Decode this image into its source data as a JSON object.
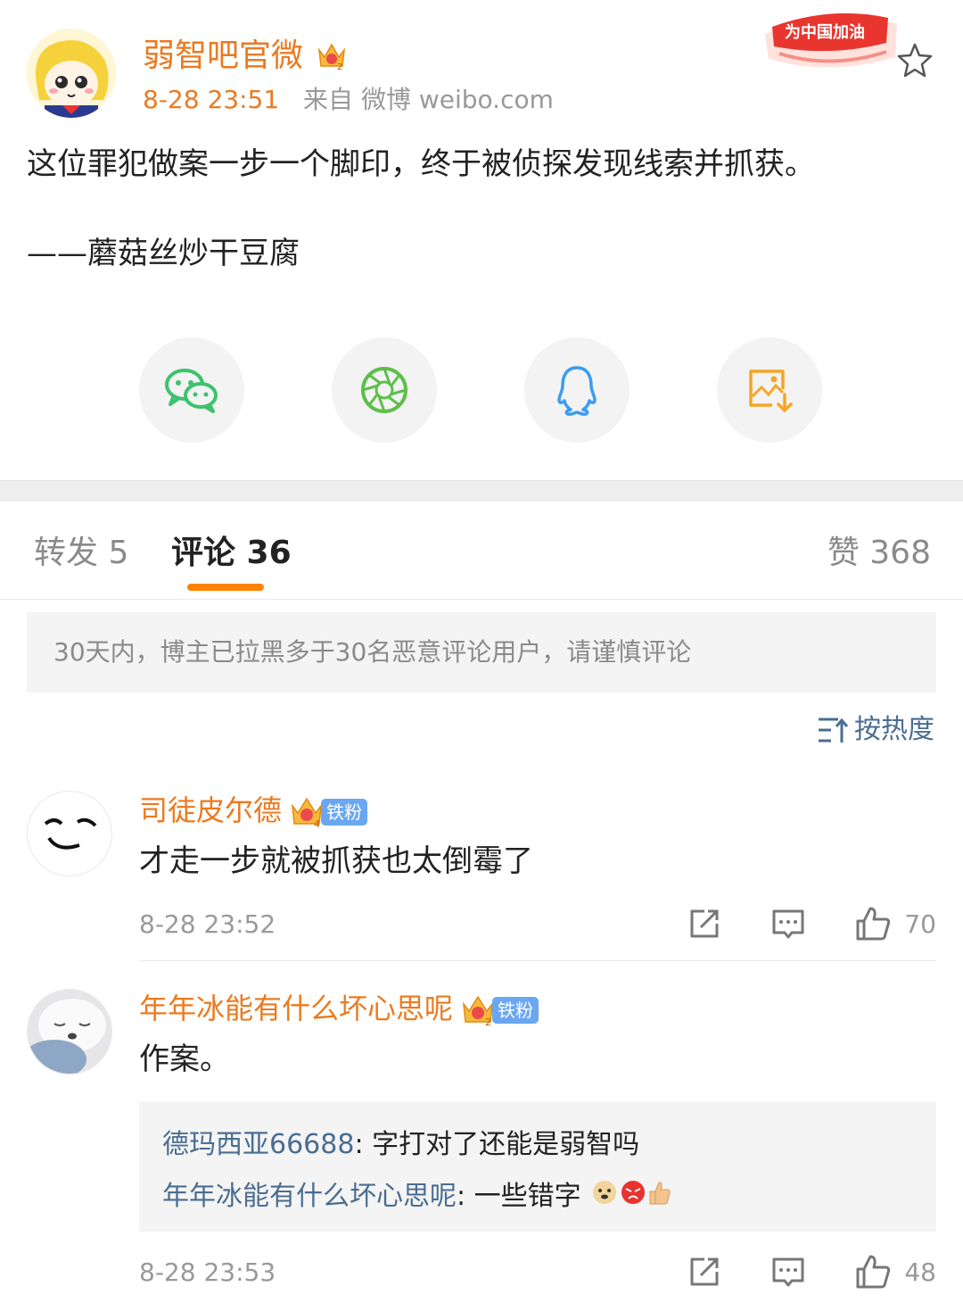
{
  "post": {
    "author": "弱智吧官微",
    "time": "8-28 23:51",
    "source": "来自 微博 weibo.com",
    "badge_text": "为中国加油",
    "text_line1": "这位罪犯做案一步一个脚印，终于被侦探发现线索并抓获。",
    "text_line2": "——蘑菇丝炒干豆腐"
  },
  "share": [
    "wechat-icon",
    "moments-icon",
    "qq-icon",
    "save-image-icon"
  ],
  "tabs": {
    "repost": "转发 5",
    "comments": "评论 36",
    "likes": "赞 368"
  },
  "notice": "30天内，博主已拉黑多于30名恶意评论用户，请谨慎评论",
  "sort_label": "按热度",
  "comments": [
    {
      "name": "司徒皮尔德",
      "fan": "铁粉",
      "text": "才走一步就被抓获也太倒霉了",
      "time": "8-28 23:52",
      "likes": "70"
    },
    {
      "name": "年年冰能有什么坏心思呢",
      "fan": "铁粉",
      "text": "作案。",
      "time": "8-28 23:53",
      "likes": "48",
      "replies": [
        {
          "name": "德玛西亚66688",
          "text": ": 字打对了还能是弱智吗"
        },
        {
          "name": "年年冰能有什么坏心思呢",
          "text": ": 一些错字"
        }
      ]
    }
  ],
  "colors": {
    "accent": "#ff8200",
    "name": "#eb7a20",
    "link": "#4a6d91",
    "wechat": "#3dc26d",
    "moments": "#5dbf4a",
    "qq": "#3b9cf2",
    "save": "#f5a623"
  }
}
